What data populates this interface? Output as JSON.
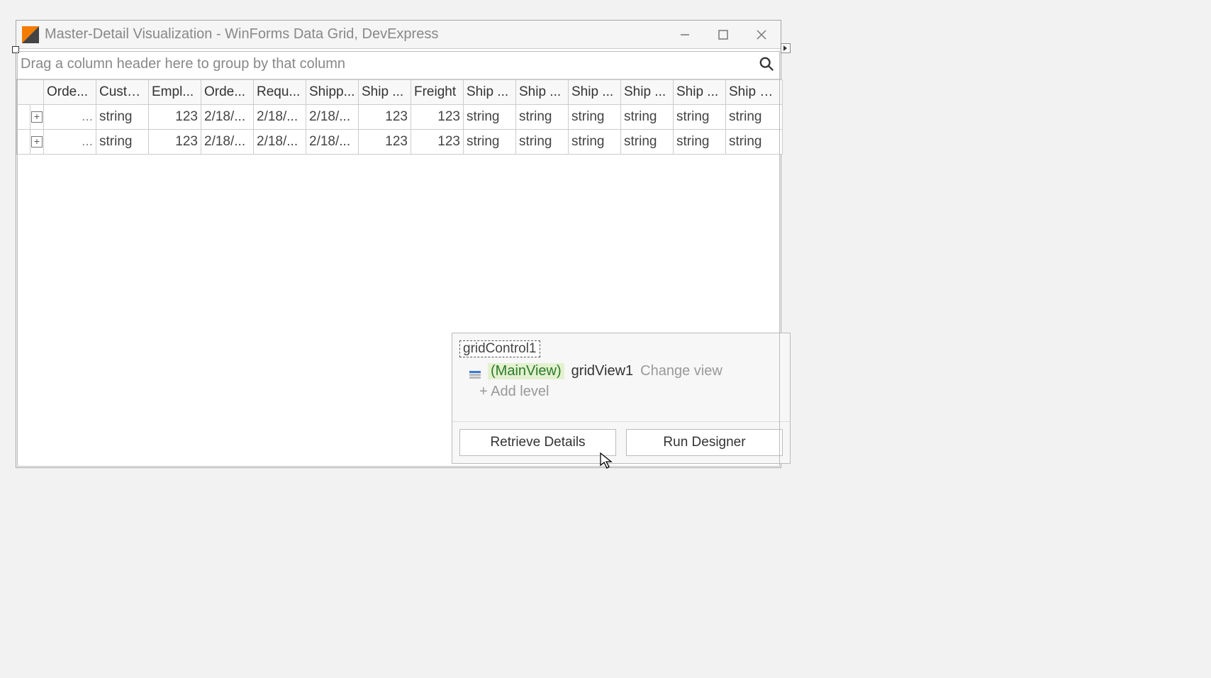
{
  "window": {
    "title": "Master-Detail Visualization - WinForms Data Grid, DevExpress"
  },
  "group_panel": {
    "hint": "Drag a column header here to group by that column"
  },
  "grid": {
    "columns": [
      "Orde...",
      "Custo...",
      "Empl...",
      "Orde...",
      "Requ...",
      "Shipp...",
      "Ship ...",
      "Freight",
      "Ship ...",
      "Ship ...",
      "Ship ...",
      "Ship ...",
      "Ship ...",
      "Ship C..."
    ],
    "rows": [
      {
        "detail": "...",
        "cells": [
          "string",
          "123",
          "2/18/...",
          "2/18/...",
          "2/18/...",
          "123",
          "123",
          "string",
          "string",
          "string",
          "string",
          "string",
          "string"
        ]
      },
      {
        "detail": "...",
        "cells": [
          "string",
          "123",
          "2/18/...",
          "2/18/...",
          "2/18/...",
          "123",
          "123",
          "string",
          "string",
          "string",
          "string",
          "string",
          "string"
        ]
      }
    ]
  },
  "designer_panel": {
    "root": "gridControl1",
    "main_view_label": "(MainView)",
    "view_name": "gridView1",
    "change_view": "Change view",
    "add_level": "+ Add level",
    "retrieve_details": "Retrieve Details",
    "run_designer": "Run Designer"
  }
}
